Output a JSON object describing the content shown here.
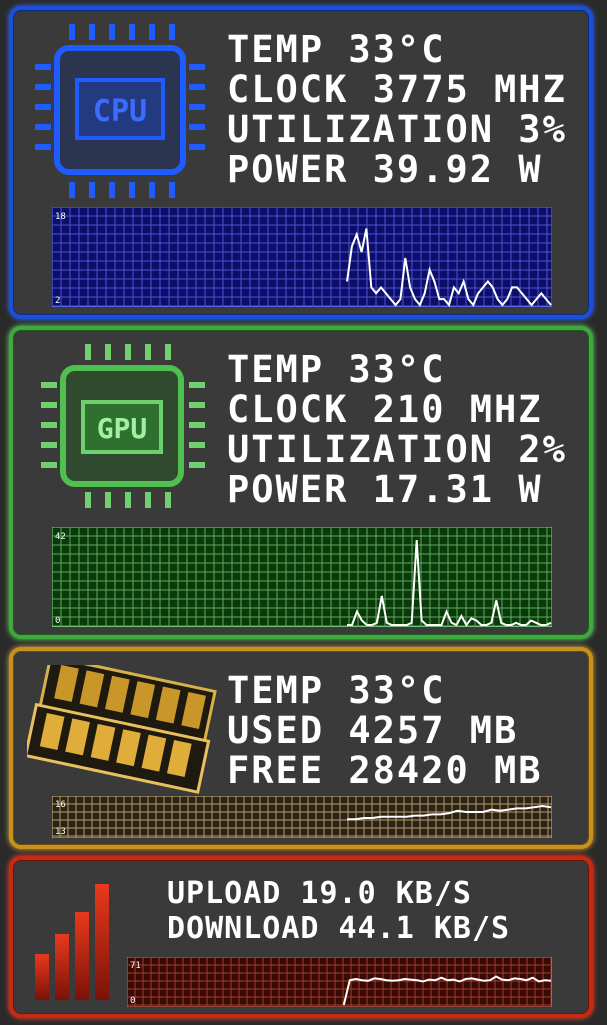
{
  "colors": {
    "cpu_accent": "#1a4fd6",
    "gpu_accent": "#3fa83f",
    "ram_accent": "#c8901c",
    "net_accent": "#c62a14"
  },
  "cpu": {
    "icon": "cpu-chip-icon",
    "icon_label": "CPU",
    "temp": "TEMP 33°C",
    "clock": "CLOCK 3775 MHZ",
    "utilization": "UTILIZATION 3%",
    "power": "POWER 39.92 W",
    "graph": {
      "max_label": "18",
      "min_label": "2",
      "ylim": [
        2,
        18
      ],
      "values": [
        6,
        12,
        14,
        11,
        15,
        5,
        4,
        5,
        4,
        3,
        2,
        3,
        10,
        5,
        3,
        2,
        4,
        8,
        6,
        3,
        3,
        2,
        5,
        4,
        6,
        3,
        2,
        4,
        5,
        6,
        5,
        3,
        2,
        3,
        5,
        5,
        4,
        3,
        2,
        3,
        4,
        3,
        2
      ]
    }
  },
  "gpu": {
    "icon": "gpu-chip-icon",
    "icon_label": "GPU",
    "temp": "TEMP 33°C",
    "clock": "CLOCK 210 MHZ",
    "utilization": "UTILIZATION 2%",
    "power": "POWER 17.31 W",
    "graph": {
      "max_label": "42",
      "min_label": "0",
      "ylim": [
        0,
        42
      ],
      "values": [
        0,
        0,
        6,
        2,
        0,
        0,
        1,
        13,
        1,
        0,
        0,
        0,
        0,
        1,
        38,
        2,
        0,
        0,
        0,
        0,
        6,
        1,
        0,
        4,
        0,
        3,
        2,
        0,
        0,
        1,
        11,
        1,
        0,
        0,
        1,
        0,
        0,
        2,
        1,
        0,
        0,
        1
      ]
    }
  },
  "ram": {
    "icon": "ram-module-icon",
    "temp": "TEMP 33°C",
    "used": "USED 4257 MB",
    "free": "FREE 28420 MB",
    "graph": {
      "max_label": "16",
      "min_label": "13",
      "ylim": [
        13,
        16
      ],
      "values": [
        14.4,
        14.4,
        14.5,
        14.5,
        14.6,
        14.6,
        14.6,
        14.6,
        14.7,
        14.7,
        14.8,
        14.8,
        14.9,
        15.1,
        15.0,
        15.0,
        15.0,
        15.2,
        15.1,
        15.2,
        15.3,
        15.3,
        15.4,
        15.5,
        15.4
      ]
    }
  },
  "network": {
    "icon": "network-bars-icon",
    "upload": "UPLOAD 19.0 KB/S",
    "download": "DOWNLOAD 44.1 KB/S",
    "graph": {
      "max_label": "71",
      "min_label": "0",
      "ylim": [
        0,
        71
      ],
      "values": [
        0,
        40,
        42,
        40,
        39,
        43,
        42,
        40,
        39,
        40,
        42,
        41,
        40,
        38,
        41,
        40,
        44,
        40,
        41,
        38,
        42,
        43,
        41,
        39,
        40,
        46,
        41,
        40,
        43,
        42,
        40,
        44,
        38,
        40,
        39
      ]
    }
  }
}
